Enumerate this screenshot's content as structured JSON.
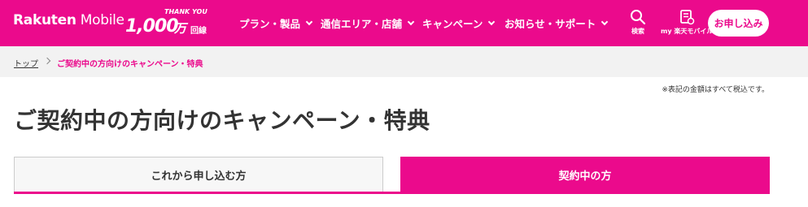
{
  "header": {
    "logo_brand": "Rakuten",
    "logo_product": " Mobile",
    "anniversary": {
      "thanks": "THANK YOU",
      "number": "1,000",
      "unit": "万",
      "unit_suffix": "回線"
    },
    "nav": [
      {
        "label": "プラン・製品"
      },
      {
        "label": "通信エリア・店舗"
      },
      {
        "label": "キャンペーン"
      },
      {
        "label": "お知らせ・サポート"
      }
    ],
    "search_label": "検索",
    "my_label": "my 楽天モバイル",
    "apply_label": "お申し込み",
    "brand_color": "#eb0a8c"
  },
  "breadcrumb": {
    "home": "トップ",
    "current": "ご契約中の方向けのキャンペーン・特典"
  },
  "tax_note": "※表記の金額はすべて税込です。",
  "page_title": "ご契約中の方向けのキャンペーン・特典",
  "tabs": [
    {
      "label": "これから申し込む方",
      "active": false
    },
    {
      "label": "契約中の方",
      "active": true
    }
  ]
}
